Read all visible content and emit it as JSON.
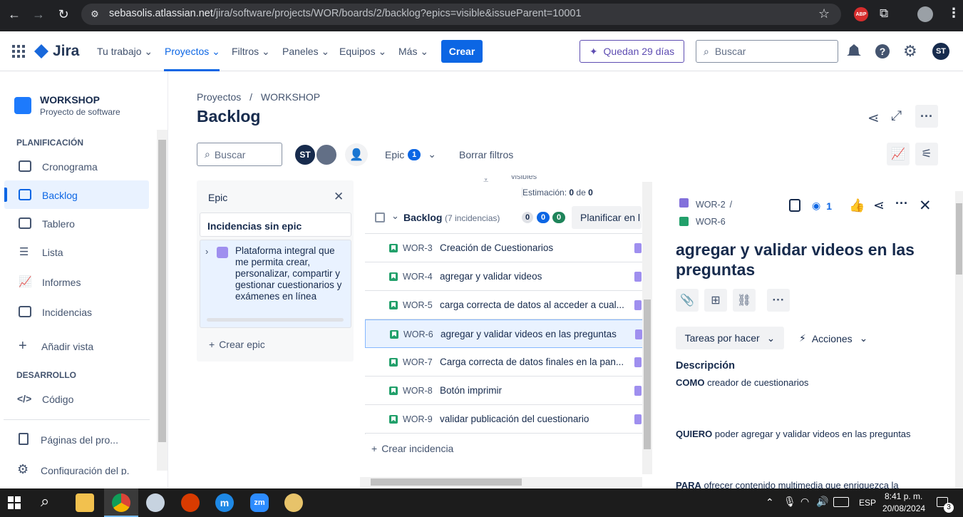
{
  "browser": {
    "url_host": "sebasolis.atlassian.net",
    "url_path": "/jira/software/projects/WOR/boards/2/backlog?epics=visible&issueParent=10001",
    "ext_badge": "ABP"
  },
  "nav": {
    "logo": "Jira",
    "items": [
      "Tu trabajo",
      "Proyectos",
      "Filtros",
      "Paneles",
      "Equipos",
      "Más"
    ],
    "create": "Crear",
    "trial": "Quedan 29 días",
    "search_placeholder": "Buscar",
    "user_initials": "ST"
  },
  "sidebar": {
    "project_name": "WORKSHOP",
    "project_type": "Proyecto de software",
    "section_planning": "PLANIFICACIÓN",
    "items": [
      "Cronograma",
      "Backlog",
      "Tablero",
      "Lista",
      "Informes",
      "Incidencias"
    ],
    "add_view": "Añadir vista",
    "section_dev": "DESARROLLO",
    "code": "Código",
    "pages": "Páginas del pro...",
    "settings": "Configuración del p..."
  },
  "page": {
    "breadcrumb_root": "Proyectos",
    "breadcrumb_sep": "/",
    "breadcrumb_project": "WORKSHOP",
    "title": "Backlog",
    "search_placeholder": "Buscar",
    "avatar_initials": "ST",
    "epic_filter": "Epic",
    "epic_filter_count": "1",
    "clear_filters": "Borrar filtros"
  },
  "epic_panel": {
    "title": "Epic",
    "no_epic": "Incidencias sin epic",
    "epic_name": "Plataforma integral que me permita crear, personalizar, compartir y gestionar cuestionarios y exámenes en línea",
    "create_epic": "Crear epic"
  },
  "backlog": {
    "partial_text": "visibles",
    "estimate_label": "Estimación:",
    "estimate_value": "0",
    "estimate_of": "de",
    "estimate_total": "0",
    "name": "Backlog",
    "count_text": "(7 incidencias)",
    "badge_gray": "0",
    "badge_blue": "0",
    "badge_green": "0",
    "plan_button": "Planificar en l",
    "create_issue": "Crear incidencia",
    "issues": [
      {
        "key": "WOR-3",
        "summary": "Creación de Cuestionarios"
      },
      {
        "key": "WOR-4",
        "summary": "agregar y validar videos"
      },
      {
        "key": "WOR-5",
        "summary": "carga correcta de datos al acceder a cual..."
      },
      {
        "key": "WOR-6",
        "summary": "agregar y validar videos en las preguntas"
      },
      {
        "key": "WOR-7",
        "summary": "Carga correcta de datos finales en la pan..."
      },
      {
        "key": "WOR-8",
        "summary": "Botón imprimir"
      },
      {
        "key": "WOR-9",
        "summary": "validar publicación del cuestionario"
      }
    ]
  },
  "detail": {
    "parent_key": "WOR-2",
    "parent_sep": "/",
    "issue_key": "WOR-6",
    "watch_count": "1",
    "title": "agregar y validar videos en las preguntas",
    "status": "Tareas por hacer",
    "actions": "Acciones",
    "description_label": "Descripción",
    "como_bold": "COMO",
    "como_text": "creador de cuestionarios",
    "quiero_bold": "QUIERO",
    "quiero_text": "poder agregar y validar videos en las preguntas",
    "para_bold": "PARA",
    "para_text": "ofrecer contenido multimedia que enriquezca la"
  },
  "taskbar": {
    "lang": "ESP",
    "time": "8:41 p. m.",
    "date": "20/08/2024",
    "notif_count": "3"
  },
  "colors": {
    "brand_blue": "#0c66e4",
    "epic_purple": "#9f8fef",
    "story_green": "#22a06b"
  }
}
